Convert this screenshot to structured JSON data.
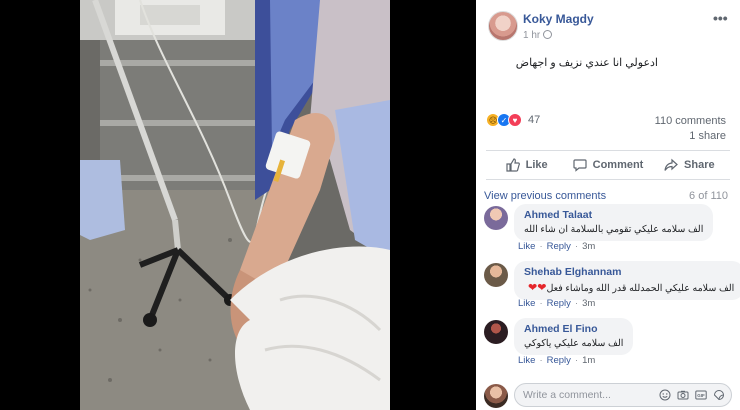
{
  "post": {
    "poster_name": "Koky Magdy",
    "time": "1 hr",
    "text": "ادعولي انا عندي نزيف و اجهاض",
    "reactions_count": "47",
    "comments_count": "110 comments",
    "shares_count": "1 share"
  },
  "actions": {
    "like": "Like",
    "comment": "Comment",
    "share": "Share"
  },
  "comments_header": {
    "view_previous": "View previous comments",
    "index": "6 of 110"
  },
  "comments": [
    {
      "name": "Ahmed Talaat",
      "text": "الف سلامه عليكي تقومي بالسلامة ان شاء الله",
      "like": "Like",
      "reply": "Reply",
      "time": "3m",
      "avatar_color": "#7a6a9a"
    },
    {
      "name": "Shehab Elghannam",
      "text": "الف سلامه عليكي الحمدلله قدر الله وماشاء فعل",
      "like": "Like",
      "reply": "Reply",
      "time": "3m",
      "avatar_color": "#6b5a48"
    },
    {
      "name": "Ahmed El Fino",
      "text": "الف سلامه عليكي ياكوكي",
      "like": "Like",
      "reply": "Reply",
      "time": "1m",
      "avatar_color": "#2b1d22"
    }
  ],
  "write_comment": {
    "placeholder": "Write a comment..."
  },
  "icons": [
    "more-icon",
    "globe-icon",
    "sad-reaction-icon",
    "like-reaction-icon",
    "love-reaction-icon",
    "like-icon",
    "comment-icon",
    "share-icon",
    "emoji-icon",
    "camera-icon",
    "gif-icon",
    "sticker-icon"
  ],
  "colors": {
    "link": "#385898",
    "muted": "#606770",
    "bubble": "#f2f3f5"
  }
}
